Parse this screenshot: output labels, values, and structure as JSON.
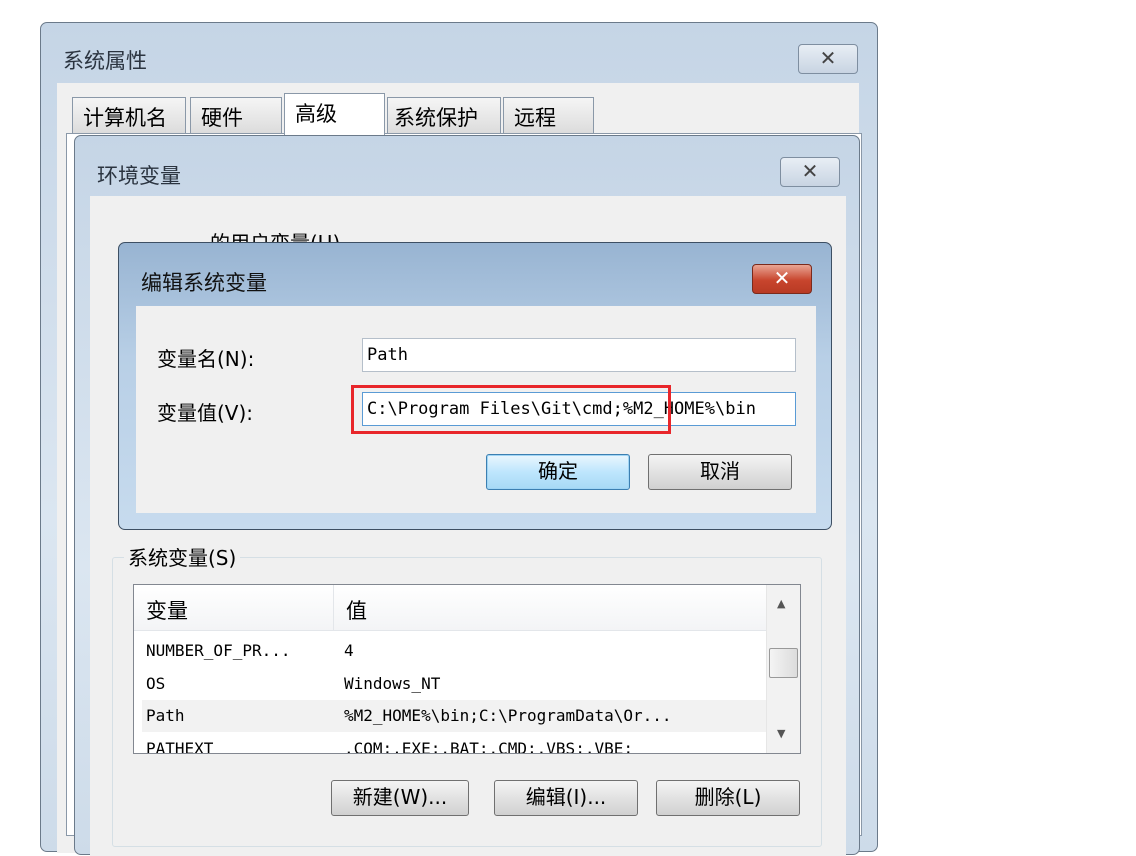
{
  "system_properties": {
    "title": "系统属性",
    "tabs": [
      "计算机名",
      "硬件",
      "高级",
      "系统保护",
      "远程"
    ],
    "selected_tab": "高级"
  },
  "env_vars": {
    "title": "环境变量",
    "user_vars_label": "的用户变量(U)",
    "system_vars_label": "系统变量(S)",
    "columns": [
      "变量",
      "值"
    ],
    "rows": [
      {
        "name": "NUMBER_OF_PR...",
        "value": "4"
      },
      {
        "name": "OS",
        "value": "Windows_NT"
      },
      {
        "name": "Path",
        "value": "%M2_HOME%\\bin;C:\\ProgramData\\Or..."
      },
      {
        "name": "PATHEXT",
        "value": ".COM;.EXE;.BAT;.CMD;.VBS;.VBE;"
      }
    ],
    "buttons": {
      "new": "新建(W)...",
      "edit": "编辑(I)...",
      "delete": "删除(L)"
    }
  },
  "edit_dialog": {
    "title": "编辑系统变量",
    "name_label": "变量名(N):",
    "value_label": "变量值(V):",
    "name_value": "Path",
    "value_value": "C:\\Program Files\\Git\\cmd;%M2_HOME%\\bin",
    "ok": "确定",
    "cancel": "取消",
    "highlight_color": "#e8262b"
  },
  "icons": {
    "close": "close-icon",
    "scroll_up": "arrow-up-icon",
    "scroll_down": "arrow-down-icon"
  }
}
